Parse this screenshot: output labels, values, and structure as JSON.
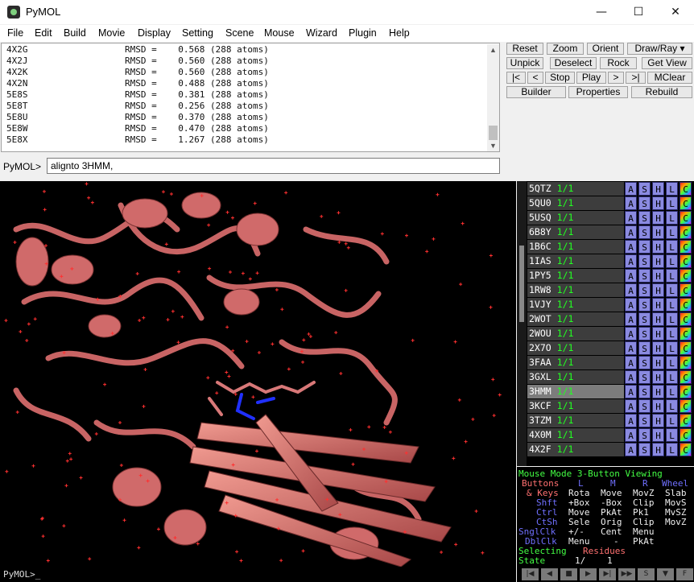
{
  "window": {
    "title": "PyMOL",
    "minimize_glyph": "—",
    "maximize_glyph": "☐",
    "close_glyph": "✕"
  },
  "menu": [
    "File",
    "Edit",
    "Build",
    "Movie",
    "Display",
    "Setting",
    "Scene",
    "Mouse",
    "Wizard",
    "Plugin",
    "Help"
  ],
  "output_lines": [
    {
      "name": "4X2G",
      "rmsd": "0.568",
      "atoms": "288"
    },
    {
      "name": "4X2J",
      "rmsd": "0.560",
      "atoms": "288"
    },
    {
      "name": "4X2K",
      "rmsd": "0.560",
      "atoms": "288"
    },
    {
      "name": "4X2N",
      "rmsd": "0.488",
      "atoms": "288"
    },
    {
      "name": "5E8S",
      "rmsd": "0.381",
      "atoms": "288"
    },
    {
      "name": "5E8T",
      "rmsd": "0.256",
      "atoms": "288"
    },
    {
      "name": "5E8U",
      "rmsd": "0.370",
      "atoms": "288"
    },
    {
      "name": "5E8W",
      "rmsd": "0.470",
      "atoms": "288"
    },
    {
      "name": "5E8X",
      "rmsd": "1.267",
      "atoms": "288"
    }
  ],
  "output_scroll": {
    "up": "▲",
    "down": "▼"
  },
  "command": {
    "label": "PyMOL>",
    "value": "alignto 3HMM,"
  },
  "buttons": {
    "row1": [
      "Reset",
      "Zoom",
      "Orient",
      "Draw/Ray ▾"
    ],
    "row2": [
      "Unpick",
      "Deselect",
      "Rock",
      "Get View"
    ],
    "row3": [
      "|<",
      "<",
      "Stop",
      "Play",
      ">",
      ">|",
      "MClear"
    ],
    "row4": [
      "Builder",
      "Properties",
      "Rebuild"
    ]
  },
  "objects": [
    {
      "name": "5QTZ",
      "state": "1/1"
    },
    {
      "name": "5QU0",
      "state": "1/1"
    },
    {
      "name": "5USQ",
      "state": "1/1"
    },
    {
      "name": "6B8Y",
      "state": "1/1"
    },
    {
      "name": "1B6C",
      "state": "1/1"
    },
    {
      "name": "1IAS",
      "state": "1/1"
    },
    {
      "name": "1PY5",
      "state": "1/1"
    },
    {
      "name": "1RW8",
      "state": "1/1"
    },
    {
      "name": "1VJY",
      "state": "1/1"
    },
    {
      "name": "2WOT",
      "state": "1/1"
    },
    {
      "name": "2WOU",
      "state": "1/1"
    },
    {
      "name": "2X7O",
      "state": "1/1"
    },
    {
      "name": "3FAA",
      "state": "1/1"
    },
    {
      "name": "3GXL",
      "state": "1/1"
    },
    {
      "name": "3HMM",
      "state": "1/1",
      "selected": true
    },
    {
      "name": "3KCF",
      "state": "1/1"
    },
    {
      "name": "3TZM",
      "state": "1/1"
    },
    {
      "name": "4X0M",
      "state": "1/1"
    },
    {
      "name": "4X2F",
      "state": "1/1"
    }
  ],
  "object_buttons": [
    "A",
    "S",
    "H",
    "L",
    "C"
  ],
  "mouse_info": {
    "title": "Mouse Mode 3-Button Viewing",
    "header": [
      "Buttons",
      "L",
      "M",
      "R",
      "Wheel"
    ],
    "rows": [
      {
        "key": "& Keys",
        "vals": [
          "Rota",
          "Move",
          "MovZ",
          "Slab"
        ]
      },
      {
        "key": "Shft",
        "vals": [
          "+Box",
          "-Box",
          "Clip",
          "MovS"
        ]
      },
      {
        "key": "Ctrl",
        "vals": [
          "Move",
          "PkAt",
          "Pk1",
          "MvSZ"
        ]
      },
      {
        "key": "CtSh",
        "vals": [
          "Sele",
          "Orig",
          "Clip",
          "MovZ"
        ]
      }
    ],
    "sngl": {
      "key": "SnglClk",
      "vals": [
        "+/-",
        "Cent",
        "Menu"
      ]
    },
    "dbl": {
      "key": "DblClk",
      "vals": [
        "Menu",
        "-",
        "PkAt"
      ]
    },
    "selecting_label": "Selecting",
    "selecting_value": "Residues",
    "state_label": "State",
    "state_value": "1/",
    "state_total": "1"
  },
  "status_prompt": "PyMOL>_",
  "movie_controls": [
    "|◀",
    "◀",
    "■",
    "▶",
    "▶|",
    "▶▶",
    "S",
    "▼",
    "F"
  ],
  "colors": {
    "cartoon": "#d87070",
    "background": "#000000",
    "water": "#ff3030",
    "nitrogen": "#2020ff"
  }
}
